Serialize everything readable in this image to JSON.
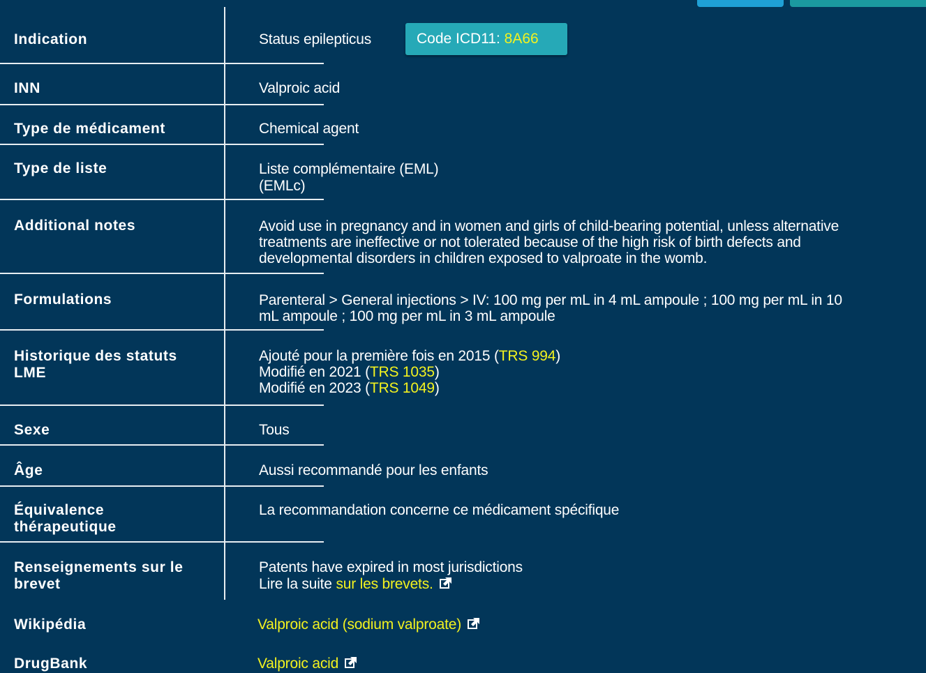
{
  "rows": {
    "indication": {
      "label": "Indication",
      "value": "Status epilepticus"
    },
    "icd": {
      "prefix": "Code ICD11: ",
      "code": "8A66"
    },
    "inn": {
      "label": "INN",
      "value": "Valproic acid"
    },
    "medicine_type": {
      "label": "Type de médicament",
      "value": "Chemical agent"
    },
    "list_type": {
      "label": "Type de liste",
      "line1": "Liste complémentaire (EML)",
      "line2": "(EMLc)"
    },
    "notes": {
      "label": "Additional notes",
      "lines": [
        "Avoid use in pregnancy and in women and girls of child-bearing potential, unless alternative",
        "treatments are ineffective or not tolerated because of the high risk of birth defects and",
        "developmental disorders in children exposed to valproate in the womb."
      ]
    },
    "formulations": {
      "label": "Formulations",
      "lines": [
        "Parenteral > General injections > IV: 100 mg per mL in 4 mL ampoule ; 100 mg per mL in 10",
        "mL ampoule ; 100 mg per mL in 3 mL ampoule"
      ]
    },
    "history": {
      "label_line1": "Historique des statuts",
      "label_line2": "LME",
      "entries": [
        {
          "text": "Ajouté pour la première fois en 2015 (",
          "link": "TRS 994",
          "close": ")"
        },
        {
          "text": "Modifié en 2021 (",
          "link": "TRS 1035",
          "close": ")"
        },
        {
          "text": "Modifié en 2023 (",
          "link": "TRS 1049",
          "close": ")"
        }
      ]
    },
    "sex": {
      "label": "Sexe",
      "value": "Tous"
    },
    "age": {
      "label": "Âge",
      "value": "Aussi recommandé pour les enfants"
    },
    "equivalence": {
      "label_line1": "Équivalence",
      "label_line2": "thérapeutique",
      "value": "La recommandation concerne ce médicament spécifique"
    },
    "patent": {
      "label_line1": "Renseignements sur le",
      "label_line2": "brevet",
      "line1": "Patents have expired in most jurisdictions",
      "line2_prefix": "Lire la suite ",
      "line2_link": "sur les brevets."
    },
    "wikipedia": {
      "label": "Wikipédia",
      "link": "Valproic acid (sodium valproate)"
    },
    "drugbank": {
      "label": "DrugBank",
      "link": "Valproic acid"
    }
  },
  "colors": {
    "background": "#023659",
    "link": "#f3f21f",
    "badge": "#26a9b7",
    "top_button_1": "#1fa0d6",
    "top_button_2": "#1b9aa0"
  },
  "icons": {
    "external_link": "external-link-icon"
  }
}
